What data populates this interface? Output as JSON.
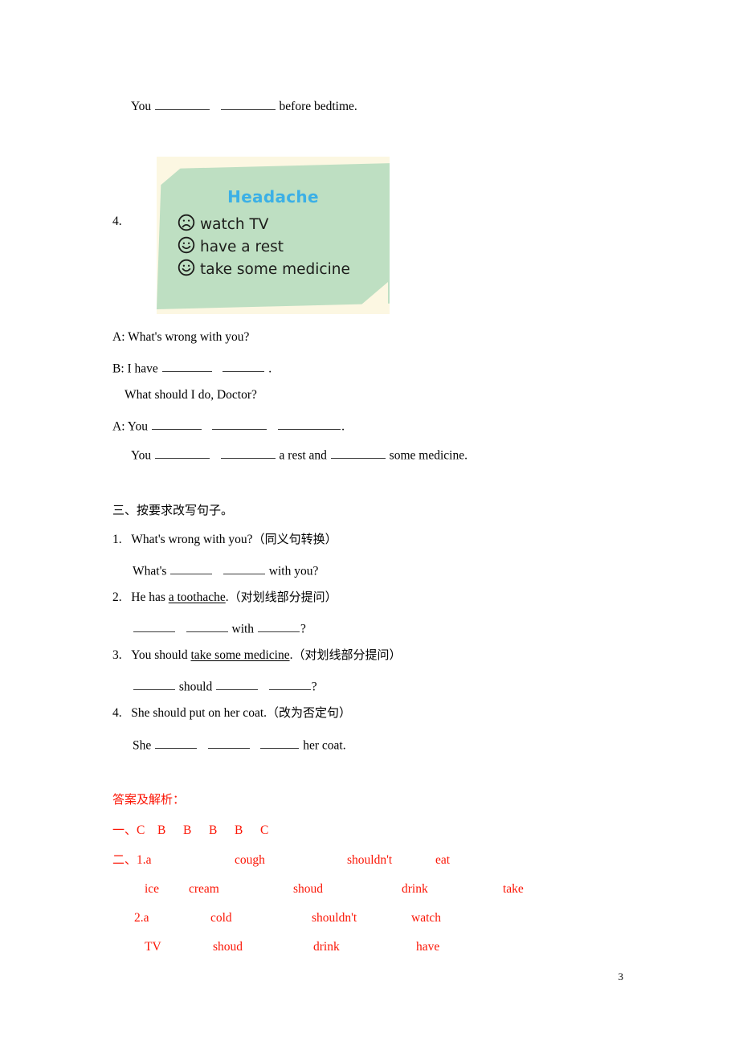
{
  "document": {
    "page_number": "3"
  },
  "carryover": {
    "line": "You _________   _________ before bedtime."
  },
  "question4": {
    "number": "4.",
    "picture": {
      "title": "Headache",
      "items": [
        {
          "face": "sad-face-icon",
          "label": "watch TV"
        },
        {
          "face": "happy-face-icon",
          "label": "have a rest"
        },
        {
          "face": "happy-face-icon",
          "label": "take some medicine"
        }
      ],
      "colors": {
        "card_background": "#fcf7e2",
        "panel": "#bedfc2",
        "title": "#3cb0e6",
        "text": "#1d1d1b"
      }
    },
    "dialogue": [
      "A: What's wrong with you?",
      "B: I have ________   _______ .",
      "What should I do, Doctor?",
      "A: You ________   _________   __________.",
      "You _________   _________ a rest and __________ some medicine."
    ]
  },
  "section3": {
    "heading": "三、按要求改写句子。",
    "items": [
      {
        "number": "1.",
        "prompt_before": "What's wrong with you?",
        "prompt_note": "（同义句转换）",
        "answer_line": "What's ______   ______ with you?"
      },
      {
        "number": "2.",
        "prompt_before": "He has ",
        "prompt_underlined": "a toothache",
        "prompt_after": ".",
        "prompt_note": "（对划线部分提问）",
        "answer_line": "______   ______ with ______?"
      },
      {
        "number": "3.",
        "prompt_before": "You should ",
        "prompt_underlined": "take some medicine",
        "prompt_after": ".",
        "prompt_note": "（对划线部分提问）",
        "answer_line": "______ should ______   ______?"
      },
      {
        "number": "4.",
        "prompt_before": "She should put on her coat.",
        "prompt_note": "（改为否定句）",
        "answer_line": "She ______   ______   ______ her coat."
      }
    ]
  },
  "answer_key": {
    "heading": "答案及解析：",
    "color": "#fb1606",
    "section1": {
      "label": "一、",
      "answers": [
        "C",
        "B",
        "B",
        "B",
        "B",
        "C"
      ]
    },
    "section2": {
      "label": "二、",
      "rows": [
        [
          "1.a",
          "cough",
          "shouldn't",
          "eat"
        ],
        [
          "ice",
          "cream",
          "shoud",
          "drink",
          "take"
        ],
        [
          "2.a",
          "cold",
          "shouldn't",
          "watch"
        ],
        [
          "TV",
          "shoud",
          "drink",
          "have"
        ]
      ]
    }
  }
}
